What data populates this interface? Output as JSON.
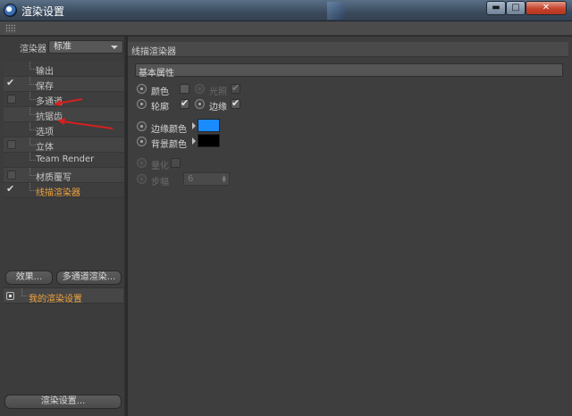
{
  "window": {
    "title": "渲染设置",
    "minimize": "▬",
    "maximize": "□",
    "close": "✕"
  },
  "left": {
    "renderer_label": "渲染器",
    "renderer_value": "标准",
    "tree": [
      {
        "label": "输出",
        "checked": false,
        "has_box": false,
        "active": false
      },
      {
        "label": "保存",
        "checked": true,
        "has_box": false,
        "active": false
      },
      {
        "label": "多通道",
        "checked": false,
        "has_box": true,
        "active": false
      },
      {
        "label": "抗锯齿",
        "checked": false,
        "has_box": false,
        "active": false
      },
      {
        "label": "选项",
        "checked": false,
        "has_box": false,
        "active": false
      },
      {
        "label": "立体",
        "checked": false,
        "has_box": true,
        "active": false
      },
      {
        "label": "Team Render",
        "checked": false,
        "has_box": false,
        "active": false
      },
      {
        "label": "材质覆写",
        "checked": false,
        "has_box": true,
        "active": false
      },
      {
        "label": "线描渲染器",
        "checked": true,
        "has_box": false,
        "active": true
      }
    ],
    "effects_button": "效果...",
    "multipass_button": "多通道渲染...",
    "preset_label": "我的渲染设置",
    "render_settings_button": "渲染设置..."
  },
  "right": {
    "section_title": "线描渲染器",
    "group_title": "基本属性",
    "props": {
      "color": {
        "label": "颜色",
        "checked": false
      },
      "illumination": {
        "label": "光照",
        "checked": true
      },
      "outline": {
        "label": "轮廓",
        "checked": true
      },
      "edges": {
        "label": "边缘",
        "checked": true
      },
      "edge_color": {
        "label": "边缘颜色",
        "color": "#1a8cff"
      },
      "background_color": {
        "label": "背景颜色",
        "color": "#000000"
      },
      "quantize": {
        "label": "量化",
        "checked": false
      },
      "steps": {
        "label": "步幅",
        "value": "6"
      }
    }
  },
  "colors": {
    "annotation_arrow": "#d42020",
    "active_text": "#f0a33c"
  }
}
